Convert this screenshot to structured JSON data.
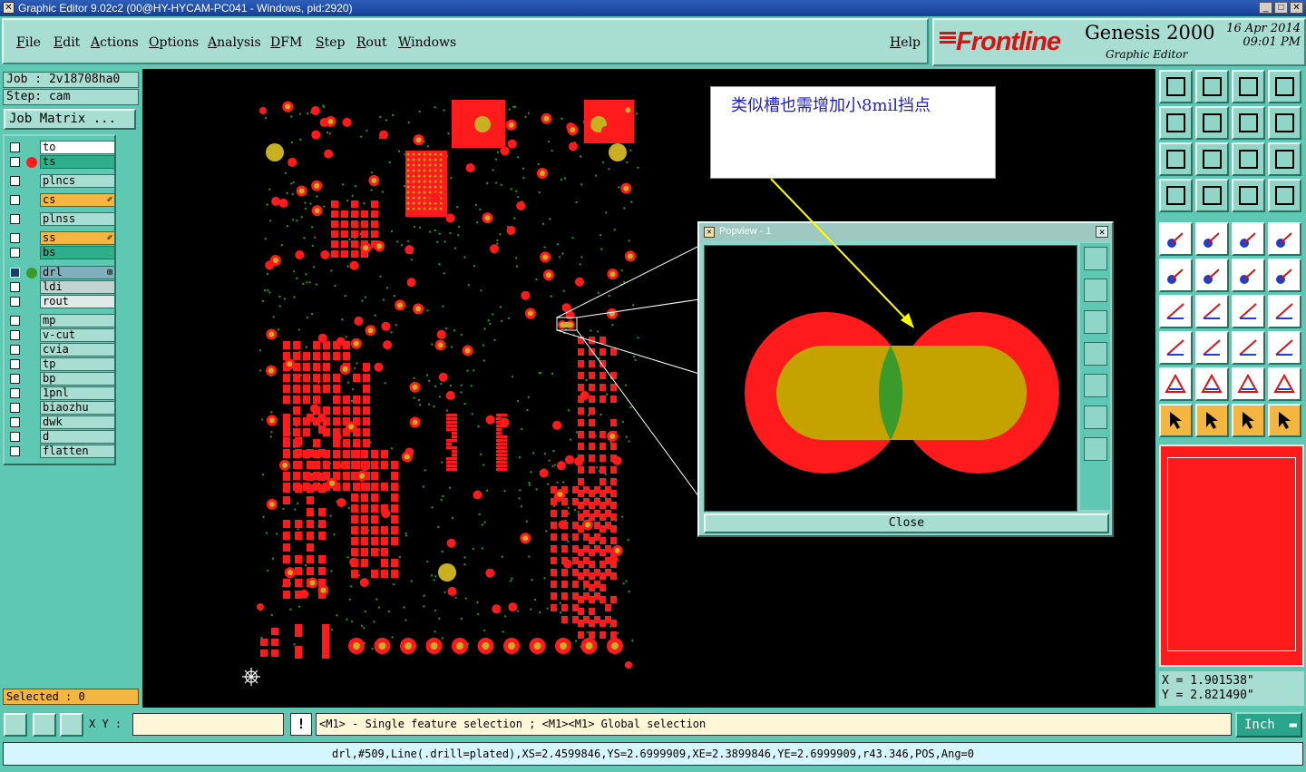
{
  "window": {
    "title": "Graphic Editor 9.02c2 (00@HY-HYCAM-PC041 - Windows, pid:2920)"
  },
  "menu": [
    "File",
    "Edit",
    "Actions",
    "Options",
    "Analysis",
    "DFM",
    "Step",
    "Rout",
    "Windows"
  ],
  "help": "Help",
  "brand": {
    "logo": "Frontline",
    "product": "Genesis 2000",
    "subtitle": "Graphic Editor",
    "date": "16 Apr 2014",
    "time": "09:01 PM"
  },
  "job": {
    "job": "Job : 2v18708ha0",
    "step": "Step: cam",
    "matrix_button": "Job Matrix ..."
  },
  "layers": [
    {
      "name": "to",
      "bg": "#ffffff",
      "dot": ""
    },
    {
      "name": "ts",
      "bg": "#2fae8a",
      "dot": "#ff1b1b"
    },
    {
      "name": "plncs",
      "bg": "#a8ddd2",
      "dot": ""
    },
    {
      "name": "cs",
      "bg": "#f4b640",
      "dot": "",
      "tag": "✐"
    },
    {
      "name": "plnss",
      "bg": "#a8ddd2",
      "dot": ""
    },
    {
      "name": "ss",
      "bg": "#f4b640",
      "dot": "",
      "tag": "✐"
    },
    {
      "name": "bs",
      "bg": "#2fae8a",
      "dot": ""
    },
    {
      "name": "drl",
      "bg": "#7fb0ba",
      "dot": "#3a9a2a",
      "tag": "⊞",
      "checked": true
    },
    {
      "name": "ldi",
      "bg": "#c4d2d2",
      "dot": ""
    },
    {
      "name": "rout",
      "bg": "#e0e8e8",
      "dot": ""
    },
    {
      "name": "mp",
      "bg": "#a8ddd2",
      "dot": ""
    },
    {
      "name": "v-cut",
      "bg": "#a8ddd2",
      "dot": ""
    },
    {
      "name": "cvia",
      "bg": "#a8ddd2",
      "dot": ""
    },
    {
      "name": "tp",
      "bg": "#a8ddd2",
      "dot": ""
    },
    {
      "name": "bp",
      "bg": "#a8ddd2",
      "dot": ""
    },
    {
      "name": "1pnl",
      "bg": "#a8ddd2",
      "dot": ""
    },
    {
      "name": "biaozhu",
      "bg": "#a8ddd2",
      "dot": ""
    },
    {
      "name": "dwk",
      "bg": "#a8ddd2",
      "dot": ""
    },
    {
      "name": "d",
      "bg": "#a8ddd2",
      "dot": ""
    },
    {
      "name": "flatten",
      "bg": "#a8ddd2",
      "dot": ""
    }
  ],
  "selected": "Selected : 0",
  "note": "类似槽也需增加小8mil挡点",
  "popview": {
    "title": "Popview - 1",
    "close": "Close"
  },
  "coords": {
    "x": "X = 1.901538\"",
    "y": "Y = 2.821490\""
  },
  "bottom": {
    "xy_label": "X Y :",
    "xy_value": "",
    "hint": "<M1> - Single feature selection ; <M1><M1> Global selection",
    "unit": "Inch"
  },
  "status": "drl,#509,Line(.drill=plated),XS=2.4599846,YS=2.6999909,XE=2.3899846,YE=2.6999909,r43.346,POS,Ang=0",
  "colors": {
    "pad": "#ff1b1b",
    "drill": "#c8b020",
    "canvas": "#000000",
    "accent": "#5fc8b2"
  }
}
